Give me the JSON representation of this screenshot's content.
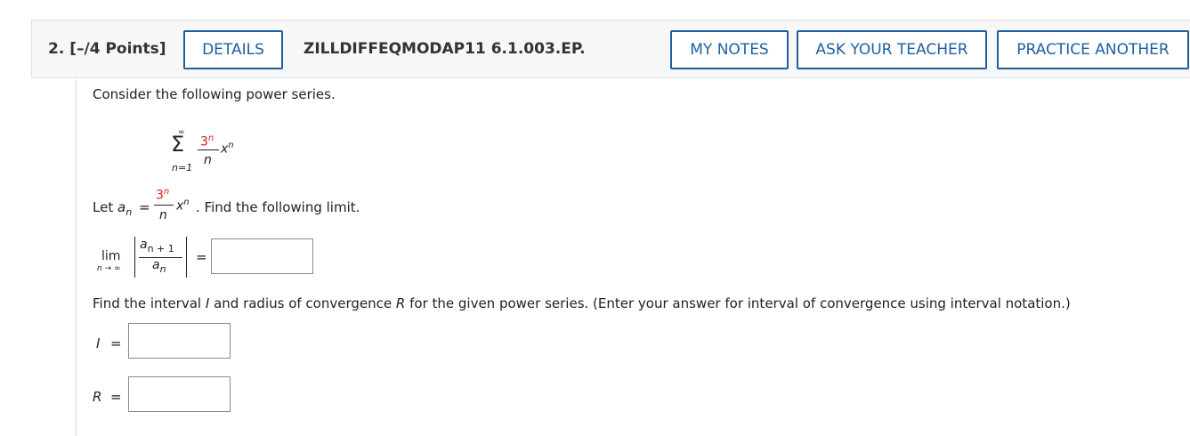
{
  "header": {
    "question_number": "2.",
    "points": "[–/4 Points]",
    "details_label": "DETAILS",
    "problem_code": "ZILLDIFFEQMODAP11 6.1.003.EP.",
    "my_notes_label": "MY NOTES",
    "ask_teacher_label": "ASK YOUR TEACHER",
    "practice_label": "PRACTICE ANOTHER"
  },
  "body": {
    "intro": "Consider the following power series.",
    "series": {
      "sigma": "Σ",
      "upper": "∞",
      "lower": "n=1",
      "numerator": "3",
      "num_exp": "n",
      "denominator": "n",
      "x": "x",
      "x_exp": "n"
    },
    "let_prefix": "Let",
    "let_a": "a",
    "let_sub": "n",
    "equals": "=",
    "let_suffix": ". Find the following limit.",
    "limit": {
      "lim": "lim",
      "under": "n → ∞",
      "top_a": "a",
      "top_sub": "n + 1",
      "bot_a": "a",
      "bot_sub": "n",
      "equals": "="
    },
    "interval_prompt_1": "Find the interval",
    "interval_var": "I",
    "interval_prompt_2": "and radius of convergence",
    "radius_var": "R",
    "interval_prompt_3": "for the given power series. (Enter your answer for interval of convergence using interval notation.)",
    "i_label": "I",
    "r_label": "R",
    "eq": "="
  }
}
